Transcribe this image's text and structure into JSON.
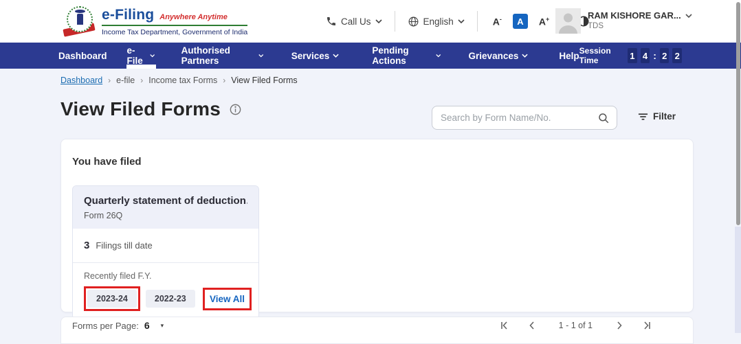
{
  "header": {
    "brand": {
      "title": "e-Filing",
      "tagline": "Anywhere Anytime",
      "subtitle": "Income Tax Department, Government of India"
    },
    "call_us": "Call Us",
    "language": "English",
    "font_decrease": "A",
    "font_decrease_sup": "-",
    "font_normal": "A",
    "font_increase": "A",
    "font_increase_sup": "+",
    "user": {
      "name": "RAM KISHORE GAR...",
      "role": "TDS"
    }
  },
  "nav": {
    "items": [
      {
        "label": "Dashboard"
      },
      {
        "label": "e-File"
      },
      {
        "label": "Authorised Partners"
      },
      {
        "label": "Services"
      },
      {
        "label": "Pending Actions"
      },
      {
        "label": "Grievances"
      },
      {
        "label": "Help"
      }
    ],
    "session": {
      "label": "Session Time",
      "d0": "1",
      "d1": "4",
      "colon": ":",
      "d2": "2",
      "d3": "2"
    }
  },
  "breadcrumb": {
    "sep": "›",
    "items": [
      {
        "label": "Dashboard"
      },
      {
        "label": "e-file"
      },
      {
        "label": "Income tax Forms"
      },
      {
        "label": "View Filed Forms"
      }
    ]
  },
  "page": {
    "title": "View Filed Forms"
  },
  "search": {
    "placeholder": "Search by Form Name/No."
  },
  "filter": {
    "label": "Filter"
  },
  "filed": {
    "section_title": "You have filed",
    "card": {
      "title": "Quarterly statement of deduction…",
      "form_no": "Form 26Q",
      "filings_count": "3",
      "filings_label": "Filings till date",
      "recent_label": "Recently filed F.Y.",
      "years": [
        {
          "label": "2023-24"
        },
        {
          "label": "2022-23"
        }
      ],
      "view_all": "View All"
    }
  },
  "pagination": {
    "per_page_label": "Forms per Page:",
    "per_page_value": "6",
    "caret": "▾",
    "range": "1 - 1 of 1"
  },
  "colors": {
    "navbar": "#2c3a91",
    "accent_blue": "#1565c0",
    "annotation_red": "#e02020",
    "brand_blue": "#1b4e9b",
    "brand_red": "#d32f2f",
    "brand_green": "#2e7d32"
  }
}
